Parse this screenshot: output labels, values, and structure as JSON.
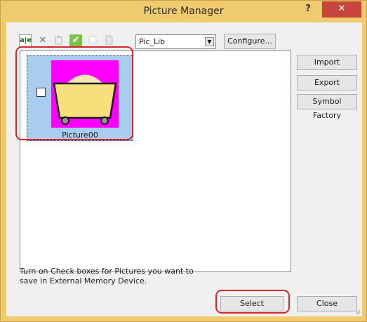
{
  "window": {
    "title": "Picture Manager"
  },
  "titlebar": {
    "help_glyph": "?",
    "close_glyph": "✕"
  },
  "toolbar": {
    "icons": [
      "rename-icon",
      "delete-icon",
      "paste-icon",
      "check-icon",
      "blank-icon",
      "doc-icon"
    ],
    "rename_glyph": "a|e",
    "delete_glyph": "✕",
    "check_glyph": "✔"
  },
  "library": {
    "selected": "Pic_Lib",
    "arrow_glyph": "▼"
  },
  "buttons": {
    "configure": "Configure...",
    "import": "Import",
    "export": "Export",
    "symbol_factory": "Symbol Factory",
    "select": "Select",
    "close": "Close"
  },
  "pictures": [
    {
      "name": "Picture00",
      "checked": false
    }
  ],
  "hint": "Turn on Check boxes for Pictures you want to save in External Memory Device.",
  "colors": {
    "title_accent": "#f0ca6e",
    "close_red": "#c7463c",
    "item_selection": "#a9cdef",
    "thumb_bg": "#ff00ff",
    "cart_fill": "#f7df7b",
    "highlight": "#d7262e"
  }
}
